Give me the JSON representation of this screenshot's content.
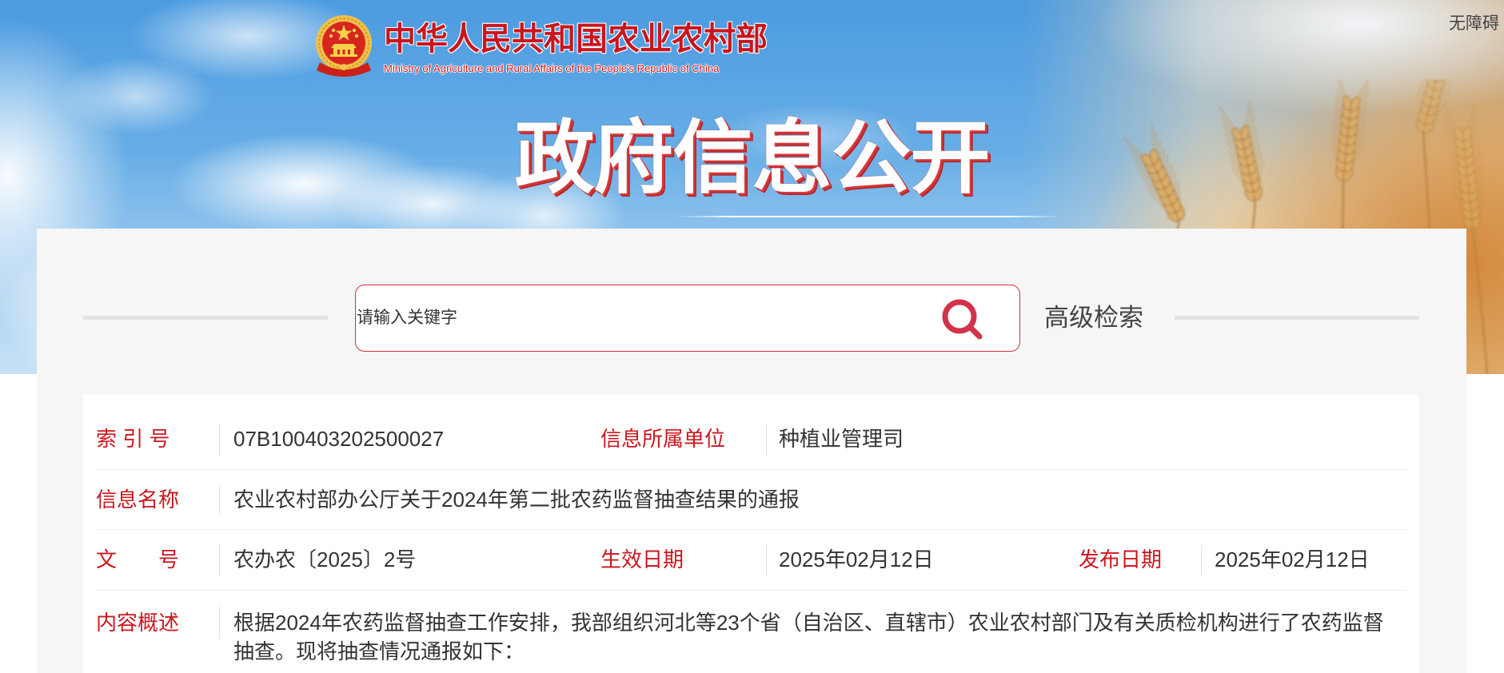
{
  "header": {
    "accessibility_link": "无障碍",
    "ministry_name_cn": "中华人民共和国农业农村部",
    "ministry_name_en": "Ministry of Agriculture and Rural Affairs of the People's Republic of China",
    "section_title": "政府信息公开",
    "emblem_icon": "national-emblem-icon"
  },
  "search": {
    "placeholder": "请输入关键字",
    "button_icon": "search-icon",
    "advanced_search_label": "高级检索"
  },
  "info": {
    "index_number": {
      "label": "索 引 号",
      "value": "07B100403202500027"
    },
    "issuing_unit": {
      "label": "信息所属单位",
      "value": "种植业管理司"
    },
    "info_title": {
      "label": "信息名称",
      "value": "农业农村部办公厅关于2024年第二批农药监督抽查结果的通报"
    },
    "document_number": {
      "label": "文　　号",
      "value": "农办农〔2025〕2号"
    },
    "effective_date": {
      "label": "生效日期",
      "value": "2025年02月12日"
    },
    "publish_date": {
      "label": "发布日期",
      "value": "2025年02月12日"
    },
    "summary": {
      "label": "内容概述",
      "value": "根据2024年农药监督抽查工作安排，我部组织河北等23个省（自治区、直辖市）农业农村部门及有关质检机构进行了农药监督抽查。现将抽查情况通报如下："
    }
  },
  "colors": {
    "brand_red": "#c8161e",
    "label_red": "#c9171e",
    "search_border": "#d1313e",
    "search_icon": "#d2334a",
    "panel_bg": "#f6f6f6"
  }
}
